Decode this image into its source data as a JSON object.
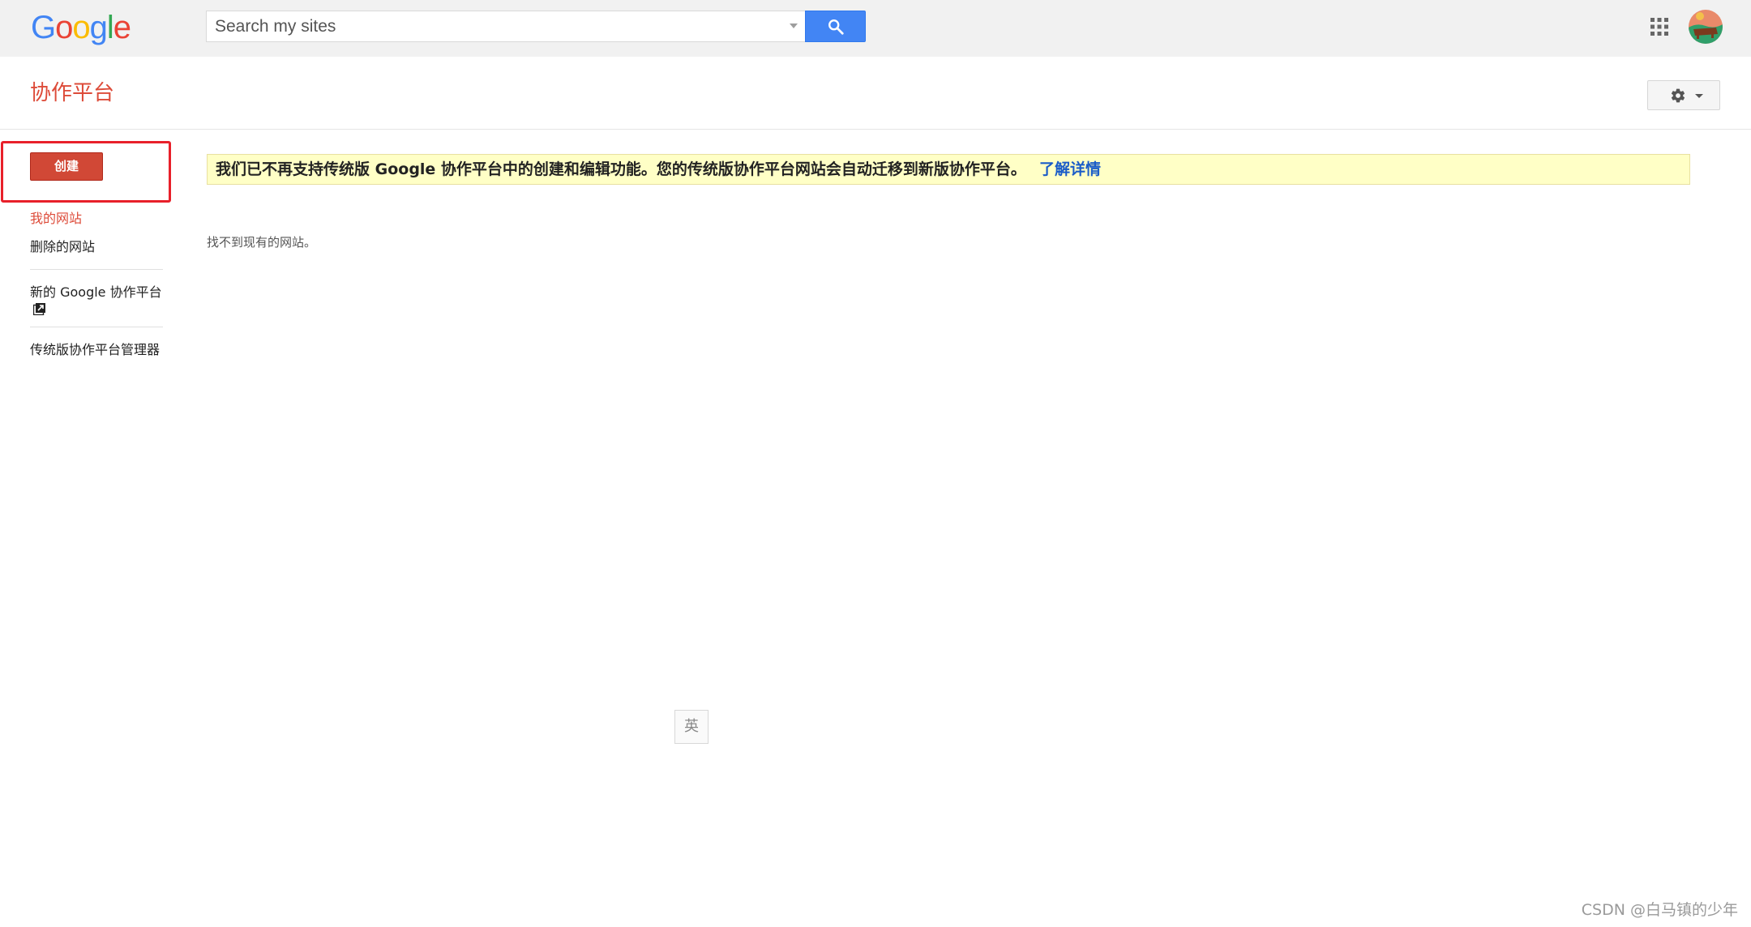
{
  "topbar": {
    "logo_letters": [
      {
        "char": "G",
        "color": "#4285f4"
      },
      {
        "char": "o",
        "color": "#ea4335"
      },
      {
        "char": "o",
        "color": "#fbbc05"
      },
      {
        "char": "g",
        "color": "#4285f4"
      },
      {
        "char": "l",
        "color": "#34a853"
      },
      {
        "char": "e",
        "color": "#ea4335"
      }
    ],
    "search_placeholder": "Search my sites",
    "search_icon": "search-icon",
    "apps_icon": "apps-grid-icon",
    "avatar_icon": "user-avatar"
  },
  "header": {
    "title": "协作平台",
    "settings_icon": "gear-icon"
  },
  "sidebar": {
    "create_label": "创建",
    "items": [
      {
        "label": "我的网站",
        "active": true
      },
      {
        "label": "删除的网站",
        "active": false
      }
    ],
    "new_sites_label": "新的 Google 协作平台",
    "external_icon": "external-link-icon",
    "legacy_manager_label": "传统版协作平台管理器"
  },
  "main": {
    "notice_text": "我们已不再支持传统版 Google 协作平台中的创建和编辑功能。您的传统版协作平台网站会自动迁移到新版协作平台。",
    "notice_link": "了解详情",
    "empty_message": "找不到现有的网站。"
  },
  "ime": {
    "label": "英"
  },
  "watermark": "CSDN @白马镇的少年",
  "colors": {
    "accent_red": "#dd4b39",
    "create_button": "#d14836",
    "search_blue": "#4285f4",
    "notice_bg": "#ffffc6",
    "link_blue": "#1a5cc8",
    "highlight_box": "#e8202a"
  }
}
